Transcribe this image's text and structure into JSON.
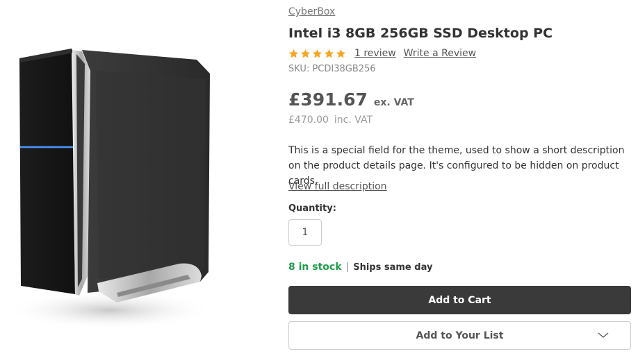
{
  "product": {
    "brand": "CyberBox",
    "title": "Intel i3 8GB 256GB SSD Desktop PC",
    "rating": 5,
    "review_count_label": "1 review",
    "write_review_label": "Write a Review",
    "sku_label": "SKU:",
    "sku": "PCDI38GB256",
    "price_ex": "£391.67",
    "price_ex_label": "ex. VAT",
    "price_inc": "£470.00",
    "price_inc_label": "inc. VAT",
    "description": "This is a special field for the theme, used to show a short description on the product details page. It's configured to be hidden on product cards.",
    "view_description_label": "View full description",
    "quantity_label": "Quantity:",
    "quantity_value": "1",
    "stock_label": "8 in stock",
    "ships_label": "Ships same day",
    "add_to_cart_label": "Add to Cart",
    "add_to_list_label": "Add to Your List",
    "image_icon": "desktop-pc-tower-image"
  },
  "colors": {
    "star": "#f5a623",
    "in_stock": "#1f9e4a",
    "cart_button": "#3a3a3a",
    "text": "#333333"
  }
}
